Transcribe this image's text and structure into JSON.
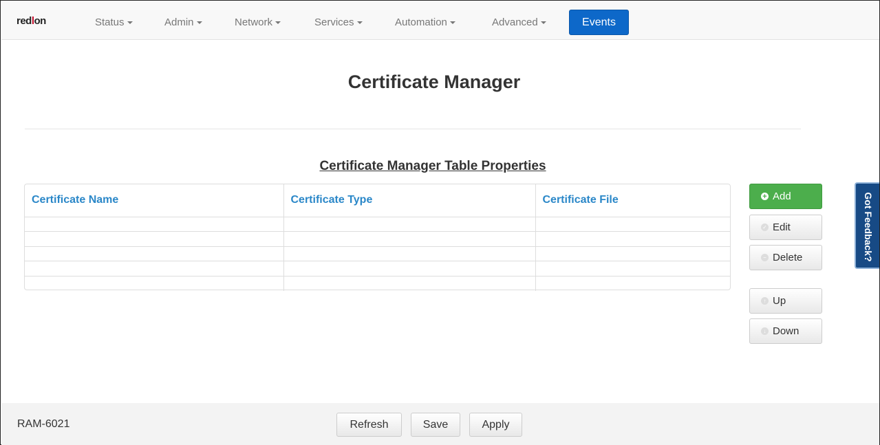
{
  "brand": {
    "logo_red": "red",
    "logo_lion": "l",
    "logo_on": "on"
  },
  "nav": {
    "items": [
      {
        "label": "Status"
      },
      {
        "label": "Admin"
      },
      {
        "label": "Network"
      },
      {
        "label": "Services"
      },
      {
        "label": "Automation"
      },
      {
        "label": "Advanced"
      }
    ],
    "events_label": "Events"
  },
  "page": {
    "title": "Certificate Manager",
    "table_title": "Certificate Manager Table Properties"
  },
  "table": {
    "columns": [
      "Certificate Name",
      "Certificate Type",
      "Certificate File"
    ],
    "rows": [
      [
        "",
        "",
        ""
      ],
      [
        "",
        "",
        ""
      ],
      [
        "",
        "",
        ""
      ],
      [
        "",
        "",
        ""
      ],
      [
        "",
        "",
        ""
      ]
    ]
  },
  "actions": {
    "add": "Add",
    "edit": "Edit",
    "delete": "Delete",
    "up": "Up",
    "down": "Down"
  },
  "feedback_label": "Got Feedback?",
  "footer": {
    "model": "RAM-6021",
    "refresh": "Refresh",
    "save": "Save",
    "apply": "Apply"
  },
  "colors": {
    "events_bg": "#0d68c9",
    "add_bg": "#4cae4c",
    "feedback_bg": "#174a85",
    "header_text": "#2a87c8"
  }
}
